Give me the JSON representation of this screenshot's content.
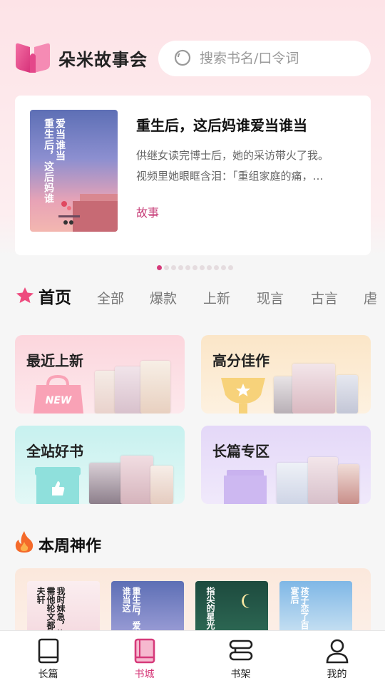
{
  "app": {
    "name": "朵米故事会"
  },
  "search": {
    "placeholder": "搜索书名/口令词"
  },
  "banner": {
    "title": "重生后，这后妈谁爱当谁当",
    "desc_line1": "供继女读完博士后，她的采访带火了我。",
    "desc_line2": "视频里她眼眶含泪：「重组家庭的痛，…",
    "tag": "故事",
    "cover_col1": "爱当谁当",
    "cover_col2": "重生后，这后妈谁",
    "page_count": 11,
    "active_page": 0
  },
  "tabs": [
    "首页",
    "全部",
    "爆款",
    "上新",
    "现言",
    "古言",
    "虐"
  ],
  "active_tab": 0,
  "categories": [
    {
      "label": "最近上新",
      "badge": "NEW"
    },
    {
      "label": "高分佳作"
    },
    {
      "label": "全站好书"
    },
    {
      "label": "长篇专区"
    }
  ],
  "weekly": {
    "title": "本周神作",
    "books": [
      {
        "cover_text": "我时妹急，换需他轮文都胎夫轩"
      },
      {
        "cover_text": "重生后，爱当谁当这"
      },
      {
        "cover_text": "指尖的星光"
      },
      {
        "cover_text": "孩子恋了百日宴后"
      }
    ]
  },
  "bottom_nav": [
    {
      "label": "长篇",
      "icon": "book-icon"
    },
    {
      "label": "书城",
      "icon": "bookstore-icon",
      "active": true
    },
    {
      "label": "书架",
      "icon": "bookshelf-icon"
    },
    {
      "label": "我的",
      "icon": "profile-icon"
    }
  ],
  "colors": {
    "accent": "#d63a7a",
    "brand_pink": "#ec4f8d"
  }
}
